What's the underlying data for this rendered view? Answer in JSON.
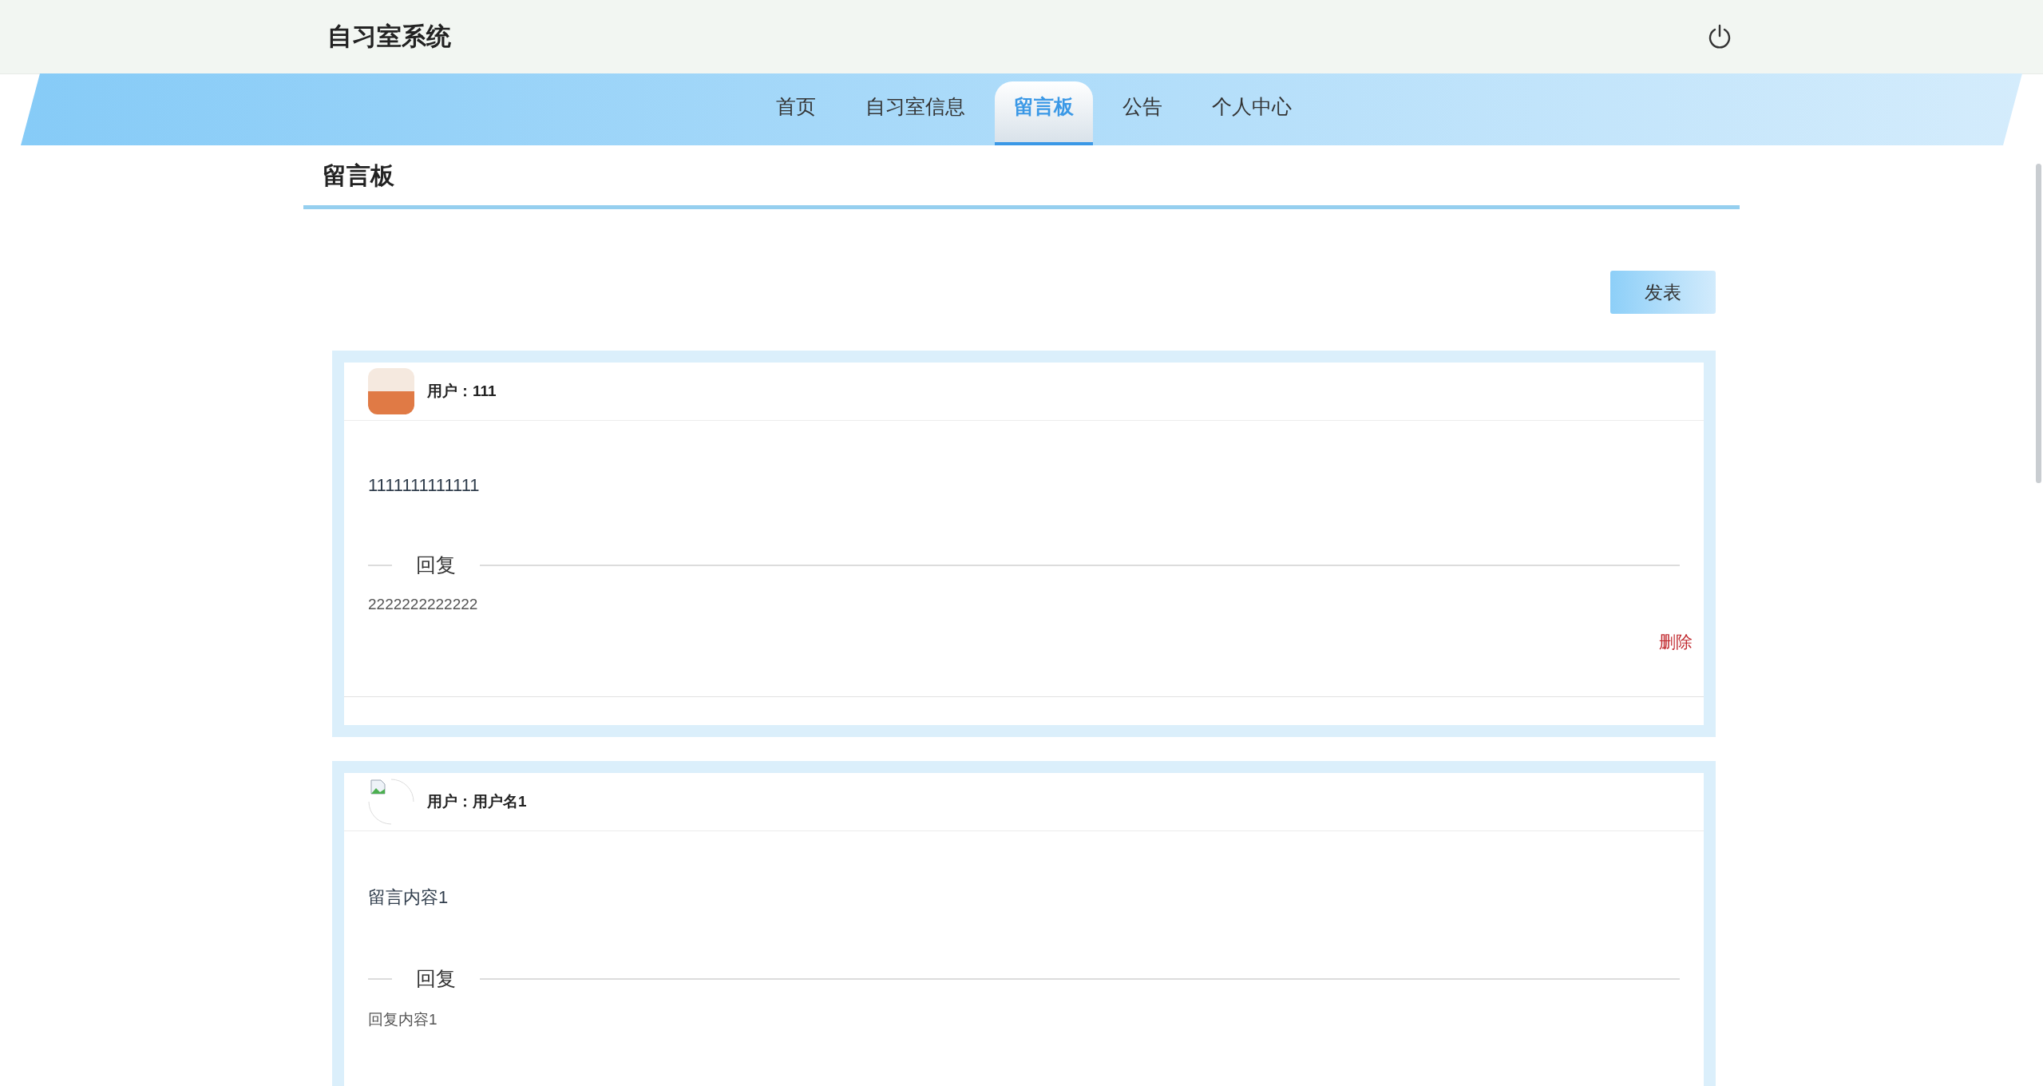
{
  "header": {
    "title": "自习室系统"
  },
  "nav": [
    {
      "label": "首页",
      "selected": false
    },
    {
      "label": "自习室信息",
      "selected": false
    },
    {
      "label": "留言板",
      "selected": true
    },
    {
      "label": "公告",
      "selected": false
    },
    {
      "label": "个人中心",
      "selected": false
    }
  ],
  "page_title": "留言板",
  "publish_button": "发表",
  "messages": [
    {
      "kind": "photo",
      "user": "用户：111",
      "content": "1111111111111",
      "reply_heading": "回复",
      "reply": "2222222222222",
      "delete_label": "删除"
    },
    {
      "kind": "broken",
      "user": "用户：用户名1",
      "content": "留言内容1",
      "reply_heading": "回复",
      "reply": "回复内容1"
    }
  ]
}
